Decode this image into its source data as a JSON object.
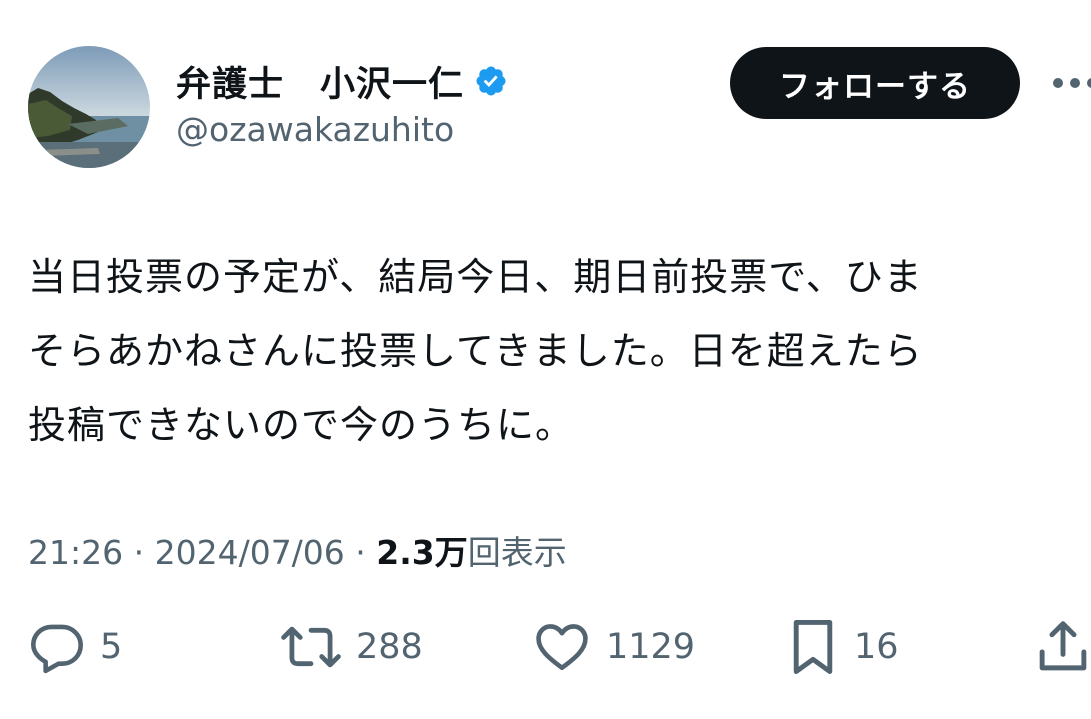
{
  "author": {
    "display_name": "弁護士　小沢一仁",
    "handle": "@ozawakazuhito",
    "verified": true,
    "verified_color": "#1d9bf0"
  },
  "follow_label": "フォローする",
  "tweet": {
    "lines": [
      "当日投票の予定が、結局今日、期日前投票で、ひま",
      "そらあかねさんに投票してきました。日を超えたら",
      "投稿できないので今のうちに。"
    ]
  },
  "meta": {
    "time": "21:26",
    "sep1": " · ",
    "date": "2024/07/06",
    "sep2": " · ",
    "views_count": "2.3万",
    "views_label": "回表示"
  },
  "actions": {
    "replies": {
      "icon": "reply-icon",
      "count": "5"
    },
    "retweets": {
      "icon": "retweet-icon",
      "count": "288"
    },
    "likes": {
      "icon": "heart-icon",
      "count": "1129"
    },
    "bookmarks": {
      "icon": "bookmark-icon",
      "count": "16"
    },
    "share": {
      "icon": "share-icon"
    }
  },
  "colors": {
    "text": "#0f1419",
    "secondary": "#536471",
    "button_bg": "#0f1419"
  }
}
